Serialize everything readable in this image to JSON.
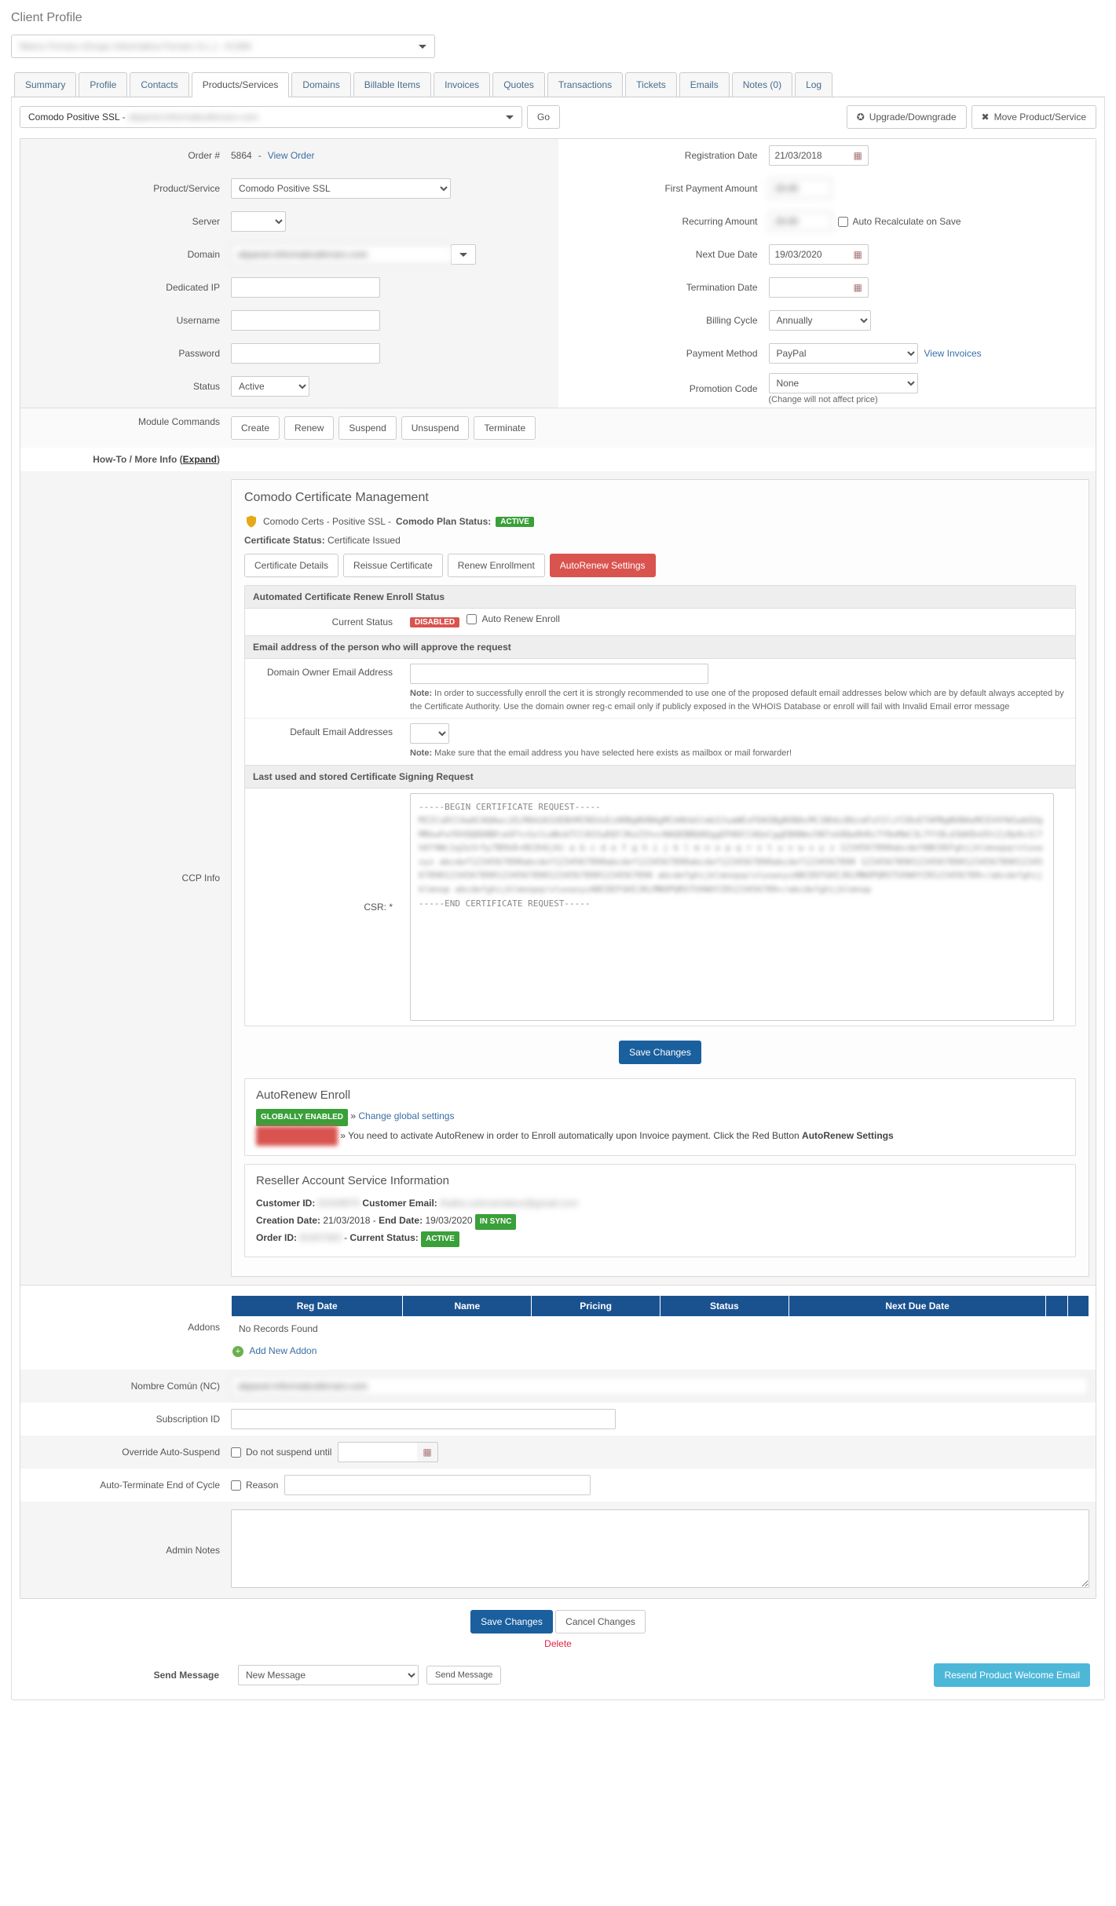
{
  "page_title": "Client Profile",
  "client_selector_value": "Marco Ferraro (Grupo Informática Ferraro S.L.) - #1394",
  "tabs": [
    "Summary",
    "Profile",
    "Contacts",
    "Products/Services",
    "Domains",
    "Billable Items",
    "Invoices",
    "Quotes",
    "Transactions",
    "Tickets",
    "Emails",
    "Notes (0)",
    "Log"
  ],
  "product_selector": "Comodo Positive SSL - ubpanel.informaticaferraro.com",
  "go_btn": "Go",
  "upgrade_btn": "Upgrade/Downgrade",
  "move_btn": "Move Product/Service",
  "left_fields": {
    "order_label": "Order #",
    "order_number": "5864",
    "view_order": "View Order",
    "product_service_label": "Product/Service",
    "product_service_value": "Comodo Positive SSL",
    "server_label": "Server",
    "server_value": "",
    "domain_label": "Domain",
    "domain_value": "ubpanel.informaticaferraro.com",
    "dedicated_ip_label": "Dedicated IP",
    "dedicated_ip_value": "",
    "username_label": "Username",
    "username_value": "",
    "password_label": "Password",
    "password_value": "",
    "status_label": "Status",
    "status_value": "Active"
  },
  "right_fields": {
    "reg_date_label": "Registration Date",
    "reg_date_value": "21/03/2018",
    "first_payment_label": "First Payment Amount",
    "first_payment_value": "29.90",
    "recurring_label": "Recurring Amount",
    "recurring_value": "29.90",
    "auto_recalc_label": "Auto Recalculate on Save",
    "next_due_label": "Next Due Date",
    "next_due_value": "19/03/2020",
    "termination_label": "Termination Date",
    "termination_value": "",
    "billing_cycle_label": "Billing Cycle",
    "billing_cycle_value": "Annually",
    "payment_method_label": "Payment Method",
    "payment_method_value": "PayPal",
    "view_invoices": "View Invoices",
    "promo_label": "Promotion Code",
    "promo_value": "None",
    "price_note": "(Change will not affect price)"
  },
  "module_commands_label": "Module Commands",
  "module_buttons": [
    "Create",
    "Renew",
    "Suspend",
    "Unsuspend",
    "Terminate"
  ],
  "howto_label": "How-To / More Info (",
  "howto_expand": "Expand",
  "howto_close": ")",
  "ccp_info_label": "CCP Info",
  "ccp": {
    "title": "Comodo Certificate Management",
    "chain": "Comodo Certs - Positive SSL - ",
    "plan_status_label": "Comodo Plan Status:",
    "plan_status_badge": "ACTIVE",
    "cert_status_label": "Certificate Status:",
    "cert_status_value": "Certificate Issued",
    "subtabs": [
      "Certificate Details",
      "Reissue Certificate",
      "Renew Enrollment",
      "AutoRenew Settings"
    ],
    "auto_panel": {
      "heading": "Automated Certificate Renew Enroll Status",
      "current_status_label": "Current Status",
      "current_status_badge": "DISABLED",
      "auto_renew_enroll_label": "Auto Renew Enroll",
      "email_heading": "Email address of the person who will approve the request",
      "domain_owner_label": "Domain Owner Email Address",
      "domain_owner_note_label": "Note:",
      "domain_owner_note": "In order to successfully enroll the cert it is strongly recommended to use one of the proposed default email addresses below which are by default always accepted by the Certificate Authority. Use the domain owner reg-c email only if publicly exposed in the WHOIS Database or enroll will fail with Invalid Email error message",
      "default_email_label": "Default Email Addresses",
      "default_email_note_label": "Note:",
      "default_email_note": "Make sure that the email address you have selected here exists as mailbox or mail forwarder!",
      "csr_heading": "Last used and stored Certificate Signing Request",
      "csr_label": "CSR: *",
      "csr_begin": "-----BEGIN CERTIFICATE REQUEST-----",
      "csr_end": "-----END CERTIFICATE REQUEST-----",
      "save_btn": "Save Changes"
    },
    "autorenew_enroll": {
      "title": "AutoRenew Enroll",
      "globally_enabled": "GLOBALLY ENABLED",
      "change_global": "Change global settings",
      "warn_text": "You need to activate AutoRenew in order to Enroll automatically upon Invoice payment. Click the Red Button ",
      "warn_btn_name": "AutoRenew Settings"
    },
    "reseller": {
      "title": "Reseller Account Service Information",
      "customer_id_label": "Customer ID:",
      "customer_id_value": "81928970",
      "customer_email_label": "Customer Email:",
      "customer_email_value": "thalles.astroamateur@gmail.com",
      "creation_label": "Creation Date:",
      "creation_value": "21/03/2018",
      "end_label": "End Date:",
      "end_value": "19/03/2020",
      "in_sync": "IN SYNC",
      "order_id_label": "Order ID:",
      "order_id_value": "81937583",
      "current_status_label": "Current Status:",
      "current_status_badge": "ACTIVE"
    }
  },
  "addons_label": "Addons",
  "addons_table_headers": [
    "Reg Date",
    "Name",
    "Pricing",
    "Status",
    "Next Due Date",
    "",
    ""
  ],
  "addons_empty": "No Records Found",
  "addons_add_link": "Add New Addon",
  "nc_label": "Nombre Común (NC)",
  "nc_value": "ubpanel.informaticaferraro.com",
  "subscription_label": "Subscription ID",
  "subscription_value": "",
  "override_label": "Override Auto-Suspend",
  "override_checkbox_label": "Do not suspend until",
  "autoterminate_label": "Auto-Terminate End of Cycle",
  "autoterminate_checkbox_label": "Reason",
  "admin_notes_label": "Admin Notes",
  "admin_notes_value": "",
  "save_changes": "Save Changes",
  "cancel_changes": "Cancel Changes",
  "delete": "Delete",
  "send_message_label": "Send Message",
  "send_message_select": "New Message",
  "send_message_btn": "Send Message",
  "resend_welcome": "Resend Product Welcome Email"
}
